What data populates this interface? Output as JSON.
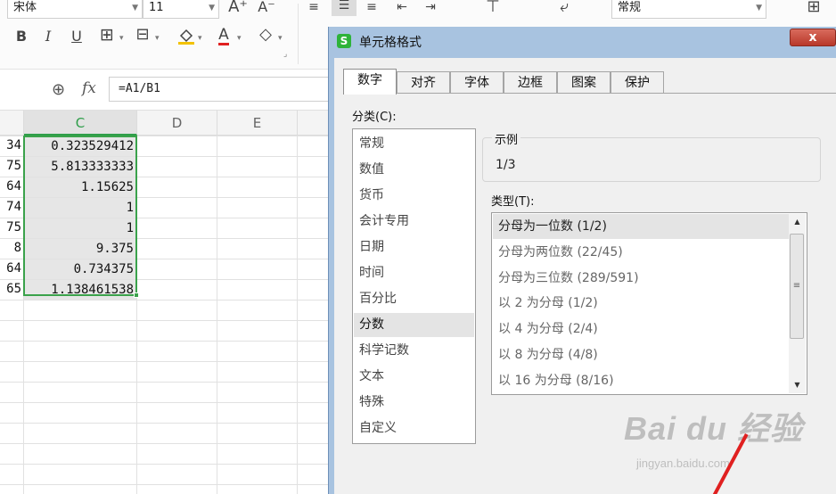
{
  "ribbon": {
    "font_name": "宋体",
    "font_size": "11",
    "number_format": "常规",
    "bold": "B",
    "italic": "I",
    "underline": "U",
    "font_color_letter": "A",
    "grow_font": "A⁺",
    "shrink_font": "A⁻"
  },
  "formula_bar": {
    "fx_label": "fx",
    "formula": "=A1/B1"
  },
  "sheet": {
    "columns": [
      "C",
      "D",
      "E"
    ],
    "b_values": [
      "34",
      "75",
      "64",
      "74",
      "75",
      "8",
      "64",
      "65"
    ],
    "c_values": [
      "0.323529412",
      "5.813333333",
      "1.15625",
      "1",
      "1",
      "9.375",
      "0.734375",
      "1.138461538"
    ]
  },
  "dialog": {
    "title": "单元格格式",
    "close_label": "x",
    "tabs": [
      "数字",
      "对齐",
      "字体",
      "边框",
      "图案",
      "保护"
    ],
    "category_label": "分类(C):",
    "categories": [
      "常规",
      "数值",
      "货币",
      "会计专用",
      "日期",
      "时间",
      "百分比",
      "分数",
      "科学记数",
      "文本",
      "特殊",
      "自定义"
    ],
    "selected_category": "分数",
    "sample_label": "示例",
    "sample_value": "1/3",
    "type_label": "类型(T):",
    "types": [
      "分母为一位数 (1/2)",
      "分母为两位数 (22/45)",
      "分母为三位数 (289/591)",
      "以 2 为分母 (1/2)",
      "以 4 为分母 (2/4)",
      "以 8 为分母 (4/8)",
      "以 16 为分母 (8/16)"
    ],
    "selected_type": "分母为一位数 (1/2)"
  },
  "watermark": {
    "main": "Bai du 经验",
    "sub": "jingyan.baidu.com"
  },
  "colors": {
    "selection": "#3aa24b",
    "dialog_frame": "#a8c3e0",
    "close_button": "#c9483a"
  }
}
